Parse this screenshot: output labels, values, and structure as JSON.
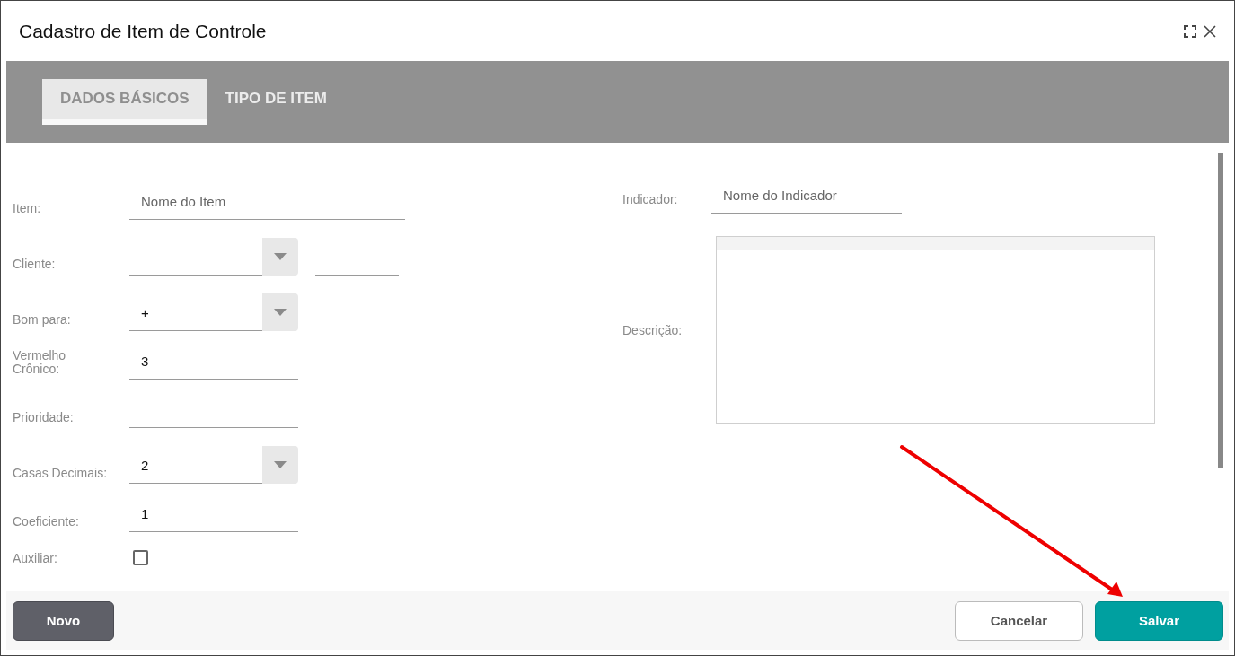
{
  "window": {
    "title": "Cadastro de Item de Controle"
  },
  "tabs": [
    {
      "label": "DADOS BÁSICOS",
      "selected": true
    },
    {
      "label": "TIPO DE ITEM",
      "selected": false
    }
  ],
  "left_fields": [
    {
      "kind": "text",
      "label": "Item:",
      "placeholder": "Nome do Item"
    },
    {
      "kind": "select_code",
      "label": "Cliente:"
    },
    {
      "kind": "select",
      "label": "Bom para:",
      "value": "+"
    },
    {
      "kind": "text",
      "label": "Vermelho Crônico:",
      "value": "3"
    },
    {
      "kind": "text",
      "label": "Prioridade:"
    },
    {
      "kind": "select",
      "label": "Casas Decimais:",
      "value": "2"
    },
    {
      "kind": "text",
      "label": "Coeficiente:",
      "value": "1"
    },
    {
      "kind": "checkbox",
      "label": "Auxiliar:",
      "checked": false
    }
  ],
  "right_fields": [
    {
      "kind": "text",
      "label": "Indicador:",
      "placeholder": "Nome do Indicador"
    },
    {
      "kind": "textarea",
      "label": "Descrição:"
    }
  ],
  "footer": {
    "left_buttons": [
      {
        "label": "Novo",
        "kind": "secondary"
      }
    ],
    "right_buttons": [
      {
        "label": "Cancelar",
        "kind": "outline"
      },
      {
        "label": "Salvar",
        "kind": "primary"
      }
    ]
  }
}
